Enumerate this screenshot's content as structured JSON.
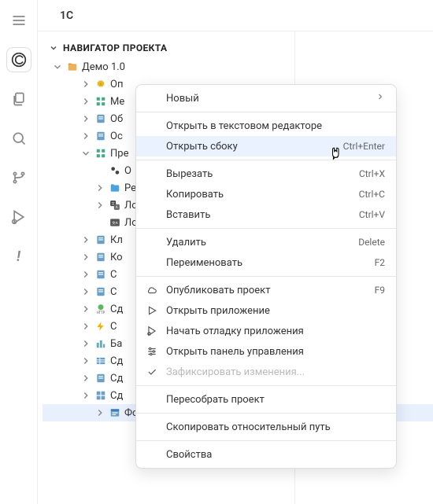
{
  "tab": {
    "title": "1C"
  },
  "explorer": {
    "section_title": "НАВИГАТОР ПРОЕКТА",
    "root": {
      "label": "Демо 1.0"
    },
    "nodes": [
      {
        "label": "Оп",
        "icon": "gear",
        "depth": 1,
        "expandable": true,
        "expanded": false
      },
      {
        "label": "Ме",
        "icon": "grid",
        "depth": 1,
        "expandable": true,
        "expanded": false
      },
      {
        "label": "Об",
        "icon": "doc",
        "depth": 1,
        "expandable": true,
        "expanded": false
      },
      {
        "label": "Ос",
        "icon": "doc",
        "depth": 1,
        "expandable": true,
        "expanded": false
      },
      {
        "label": "Пре",
        "icon": "grid",
        "depth": 1,
        "expandable": true,
        "expanded": true
      },
      {
        "label": "О",
        "icon": "gears",
        "depth": 2,
        "expandable": false,
        "expanded": false
      },
      {
        "label": "Ре",
        "icon": "folder",
        "depth": 2,
        "expandable": true,
        "expanded": false
      },
      {
        "label": "Ло",
        "icon": "lang",
        "depth": 2,
        "expandable": true,
        "expanded": false
      },
      {
        "label": "Ло",
        "icon": "lang2",
        "depth": 2,
        "expandable": false,
        "expanded": false
      },
      {
        "label": "Кл",
        "icon": "doc",
        "depth": 1,
        "expandable": true,
        "expanded": false
      },
      {
        "label": "Ко",
        "icon": "doc",
        "depth": 1,
        "expandable": true,
        "expanded": false
      },
      {
        "label": "С",
        "icon": "doc",
        "depth": 1,
        "expandable": true,
        "expanded": false
      },
      {
        "label": "С",
        "icon": "doc",
        "depth": 1,
        "expandable": true,
        "expanded": false
      },
      {
        "label": "Сд",
        "icon": "http",
        "depth": 1,
        "expandable": true,
        "expanded": false
      },
      {
        "label": "С",
        "icon": "bolt",
        "depth": 1,
        "expandable": true,
        "expanded": false
      },
      {
        "label": "Ба",
        "icon": "city",
        "depth": 1,
        "expandable": true,
        "expanded": false
      },
      {
        "label": "Сд",
        "icon": "table",
        "depth": 1,
        "expandable": true,
        "expanded": false
      },
      {
        "label": "Сд",
        "icon": "doc",
        "depth": 1,
        "expandable": true,
        "expanded": false
      },
      {
        "label": "Сд",
        "icon": "tile",
        "depth": 1,
        "expandable": true,
        "expanded": false
      },
      {
        "label": "ФормаВыбораконтактноголица",
        "icon": "form",
        "depth": 2,
        "expandable": true,
        "expanded": false,
        "selected": true
      }
    ]
  },
  "context_menu": {
    "items": [
      {
        "label": "Новый",
        "submenu": true
      },
      {
        "sep": true
      },
      {
        "label": "Открыть в текстовом редакторе"
      },
      {
        "label": "Открыть сбоку",
        "shortcut": "Ctrl+Enter",
        "hovered": true
      },
      {
        "sep": true
      },
      {
        "label": "Вырезать",
        "shortcut": "Ctrl+X"
      },
      {
        "label": "Копировать",
        "shortcut": "Ctrl+C"
      },
      {
        "label": "Вставить",
        "shortcut": "Ctrl+V"
      },
      {
        "sep": true
      },
      {
        "label": "Удалить",
        "shortcut": "Delete"
      },
      {
        "label": "Переименовать",
        "shortcut": "F2"
      },
      {
        "sep": true
      },
      {
        "label": "Опубликовать проект",
        "shortcut": "F9",
        "icon": "cloud"
      },
      {
        "label": "Открыть приложение",
        "icon": "play"
      },
      {
        "label": "Начать отладку приложения",
        "icon": "debug"
      },
      {
        "label": "Открыть панель управления",
        "icon": "sliders"
      },
      {
        "label": "Зафиксировать изменения...",
        "icon": "check",
        "disabled": true
      },
      {
        "sep": true
      },
      {
        "label": "Пересобрать проект"
      },
      {
        "sep": true
      },
      {
        "label": "Скопировать относительный путь"
      },
      {
        "sep": true
      },
      {
        "label": "Свойства"
      }
    ]
  }
}
